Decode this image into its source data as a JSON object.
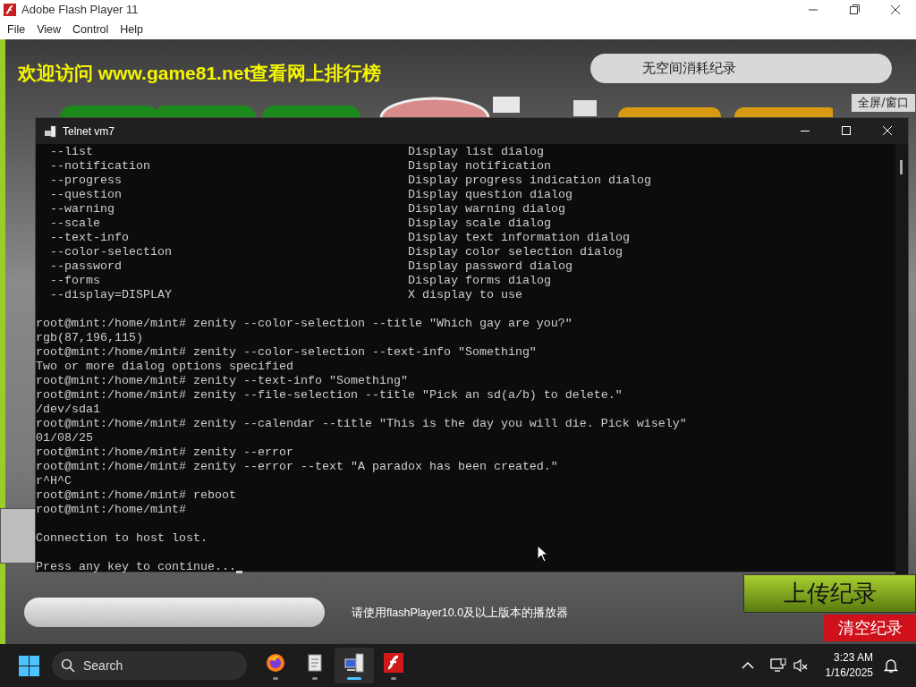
{
  "flash_window": {
    "title": "Adobe Flash Player 11",
    "menu": [
      "File",
      "View",
      "Control",
      "Help"
    ]
  },
  "game": {
    "banner": "欢迎访问 www.game81.net查看网上排行榜",
    "record_box": "无空间消耗纪录",
    "fullscreen_button": "全屏/窗口",
    "notice": "请使用flashPlayer10.0及以上版本的播放器",
    "upload_button": "上传纪录",
    "clear_button": "清空纪录"
  },
  "telnet": {
    "title": "Telnet vm7",
    "options": [
      {
        "flag": "--list",
        "description": "Display list dialog"
      },
      {
        "flag": "--notification",
        "description": "Display notification"
      },
      {
        "flag": "--progress",
        "description": "Display progress indication dialog"
      },
      {
        "flag": "--question",
        "description": "Display question dialog"
      },
      {
        "flag": "--warning",
        "description": "Display warning dialog"
      },
      {
        "flag": "--scale",
        "description": "Display scale dialog"
      },
      {
        "flag": "--text-info",
        "description": "Display text information dialog"
      },
      {
        "flag": "--color-selection",
        "description": "Display color selection dialog"
      },
      {
        "flag": "--password",
        "description": "Display password dialog"
      },
      {
        "flag": "--forms",
        "description": "Display forms dialog"
      },
      {
        "flag": "--display=DISPLAY",
        "description": "X display to use"
      }
    ],
    "blocks": [
      {
        "lines": [
          {
            "text": "root@mint:/home/mint# zenity --color-selection --title \"Which gay are you?\"",
            "cursor": false
          },
          {
            "text": "rgb(87,196,115)",
            "cursor": false
          },
          {
            "text": "root@mint:/home/mint# zenity --color-selection --text-info \"Something\"",
            "cursor": false
          },
          {
            "text": "Two or more dialog options specified",
            "cursor": false
          },
          {
            "text": "root@mint:/home/mint# zenity --text-info \"Something\"",
            "cursor": false
          },
          {
            "text": "root@mint:/home/mint# zenity --file-selection --title \"Pick an sd(a/b) to delete.\"",
            "cursor": false
          },
          {
            "text": "/dev/sda1",
            "cursor": false
          },
          {
            "text": "root@mint:/home/mint# zenity --calendar --title \"This is the day you will die. Pick wisely\"",
            "cursor": false
          },
          {
            "text": "01/08/25",
            "cursor": false
          },
          {
            "text": "root@mint:/home/mint# zenity --error",
            "cursor": false
          },
          {
            "text": "root@mint:/home/mint# zenity --error --text \"A paradox has been created.\"",
            "cursor": false
          },
          {
            "text": "r^H^C",
            "cursor": false
          },
          {
            "text": "root@mint:/home/mint# reboot",
            "cursor": false
          },
          {
            "text": "root@mint:/home/mint#",
            "cursor": false
          }
        ]
      },
      {
        "lines": [
          {
            "text": "Connection to host lost.",
            "cursor": false
          }
        ]
      },
      {
        "lines": [
          {
            "text": "Press any key to continue...",
            "cursor": true
          }
        ]
      }
    ]
  },
  "taskbar": {
    "search_placeholder": "Search",
    "apps": [
      {
        "kind": "firefox",
        "selected": false
      },
      {
        "kind": "notepad",
        "selected": false
      },
      {
        "kind": "telnet",
        "selected": true
      },
      {
        "kind": "flash",
        "selected": false
      }
    ],
    "time": "3:23 AM",
    "date": "1/16/2025"
  }
}
